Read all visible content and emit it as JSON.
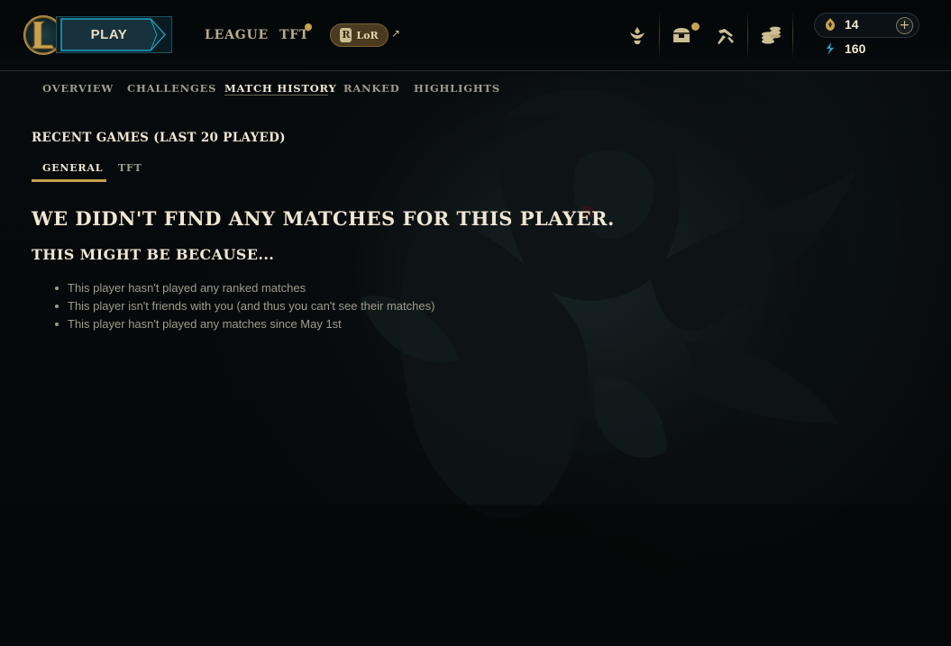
{
  "topbar": {
    "play_label": "PLAY",
    "nav": [
      {
        "label": "LEAGUE"
      },
      {
        "label": "TFT",
        "has_notification": true
      }
    ],
    "lor_label": "LoR",
    "lor_badge": "R",
    "external_glyph": "↗",
    "icons": [
      "home-trophy-icon",
      "loot-bag-icon",
      "crafting-icon",
      "store-icon"
    ],
    "loot_has_notification": true,
    "currency": {
      "rp_value": "14",
      "be_value": "160",
      "add_glyph": "+"
    },
    "accent_color": "#c8a24e"
  },
  "subnav": {
    "items": [
      {
        "label": "OVERVIEW",
        "active": false
      },
      {
        "label": "CHALLENGES",
        "active": false
      },
      {
        "label": "MATCH HISTORY",
        "active": true
      },
      {
        "label": "RANKED",
        "active": false
      },
      {
        "label": "HIGHLIGHTS",
        "active": false
      }
    ]
  },
  "main": {
    "section_title": "RECENT GAMES (LAST 20 PLAYED)",
    "tabs": [
      {
        "label": "GENERAL",
        "active": true
      },
      {
        "label": "TFT",
        "active": false
      }
    ],
    "empty_heading": "WE DIDN'T FIND ANY MATCHES FOR THIS PLAYER.",
    "empty_subheading": "THIS MIGHT BE BECAUSE...",
    "reasons": [
      "This player hasn't played any ranked matches",
      "This player isn't friends with you (and thus you can't see their matches)",
      "This player hasn't played any matches since May 1st"
    ]
  }
}
